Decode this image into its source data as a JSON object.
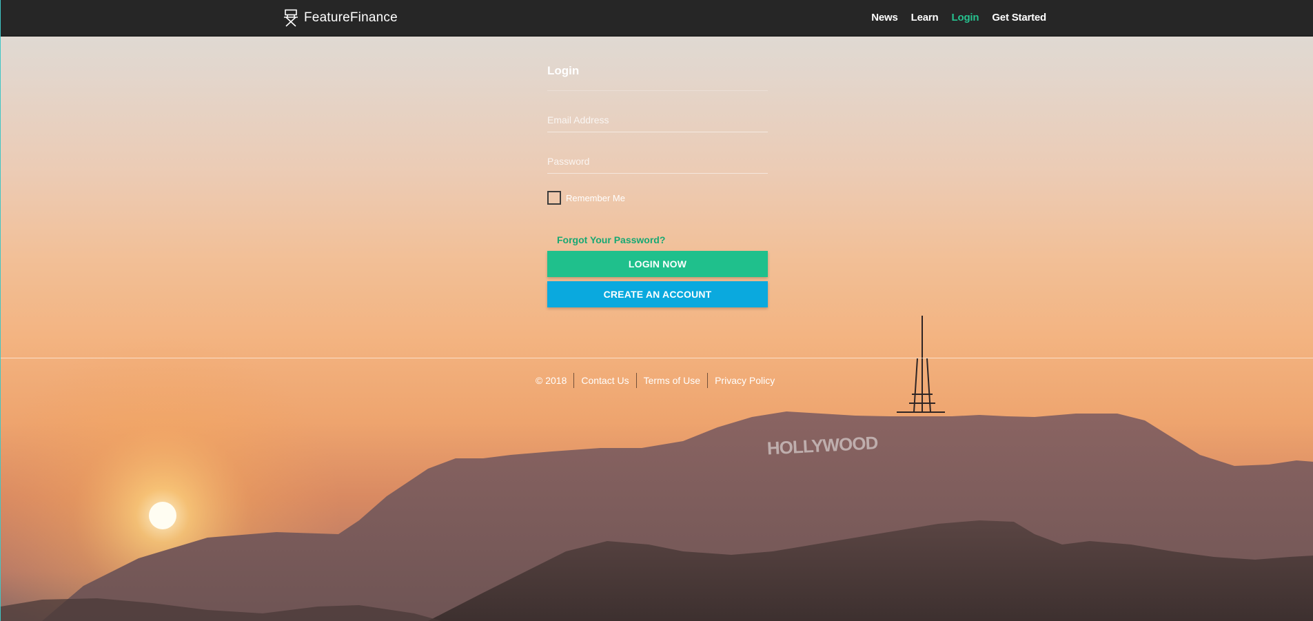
{
  "brand": {
    "name": "FeatureFinance",
    "icon": "directors-chair-icon"
  },
  "nav": {
    "items": [
      {
        "label": "News"
      },
      {
        "label": "Learn"
      },
      {
        "label": "Login"
      },
      {
        "label": "Get Started"
      }
    ],
    "active": "Login"
  },
  "login": {
    "title": "Login",
    "email_placeholder": "Email Address",
    "email_value": "",
    "password_placeholder": "Password",
    "password_value": "",
    "remember_label": "Remember Me",
    "remember_checked": false,
    "forgot_label": "Forgot Your Password?",
    "login_button": "LOGIN NOW",
    "create_button": "CREATE AN ACCOUNT"
  },
  "footer": {
    "copyright": "© 2018",
    "links": [
      {
        "label": "Contact Us"
      },
      {
        "label": "Terms of Use"
      },
      {
        "label": "Privacy Policy"
      }
    ]
  },
  "background": {
    "sign_text": "HOLLYWOOD"
  },
  "colors": {
    "accent_green": "#1fc08c",
    "accent_blue": "#0aa9de",
    "nav_bg": "#262626",
    "active_link": "#26c28f"
  }
}
